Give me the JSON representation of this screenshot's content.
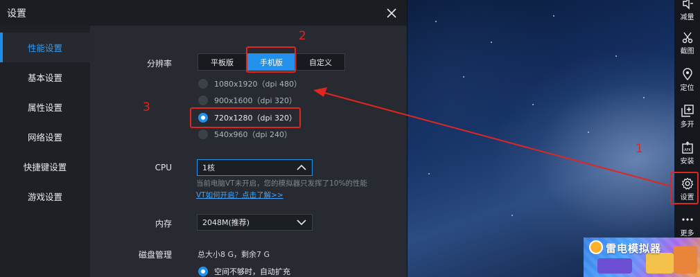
{
  "dialog": {
    "title": "设置",
    "close_icon": "close-icon"
  },
  "sidebar": {
    "items": [
      {
        "label": "性能设置",
        "active": true
      },
      {
        "label": "基本设置"
      },
      {
        "label": "属性设置"
      },
      {
        "label": "网络设置"
      },
      {
        "label": "快捷键设置"
      },
      {
        "label": "游戏设置"
      }
    ]
  },
  "resolution": {
    "label": "分辨率",
    "modes": [
      "平板版",
      "手机版",
      "自定义"
    ],
    "selected_mode": "手机版",
    "options": [
      {
        "label": "1080x1920（dpi 480）",
        "selected": false
      },
      {
        "label": "900x1600（dpi 320）",
        "selected": false
      },
      {
        "label": "720x1280（dpi 320）",
        "selected": true
      },
      {
        "label": "540x960（dpi 240）",
        "selected": false
      }
    ]
  },
  "cpu": {
    "label": "CPU",
    "value": "1核",
    "hint": "当前电脑VT未开启，您的模拟器只发挥了10%的性能",
    "link": "VT如何开启？点击了解>>"
  },
  "memory": {
    "label": "内存",
    "value": "2048M(推荐)"
  },
  "disk": {
    "label": "磁盘管理",
    "summary": "总大小8 G，剩余7 G",
    "option": "空间不够时，自动扩充"
  },
  "annotations": [
    "1",
    "2",
    "3"
  ],
  "toolbar": {
    "items": [
      {
        "label": "减量",
        "icon": "volume-down-icon"
      },
      {
        "label": "截图",
        "icon": "scissors-icon"
      },
      {
        "label": "定位",
        "icon": "location-pin-icon"
      },
      {
        "label": "多开",
        "icon": "multi-open-icon"
      },
      {
        "label": "安装",
        "icon": "apk-install-icon"
      },
      {
        "label": "设置",
        "icon": "gear-icon"
      },
      {
        "label": "更多",
        "icon": "more-dots-icon"
      }
    ]
  },
  "promo": {
    "text": "雷电模拟器"
  },
  "colors": {
    "accent": "#2191ec",
    "annotation": "#e0261f",
    "dialog_bg": "#272b31"
  }
}
